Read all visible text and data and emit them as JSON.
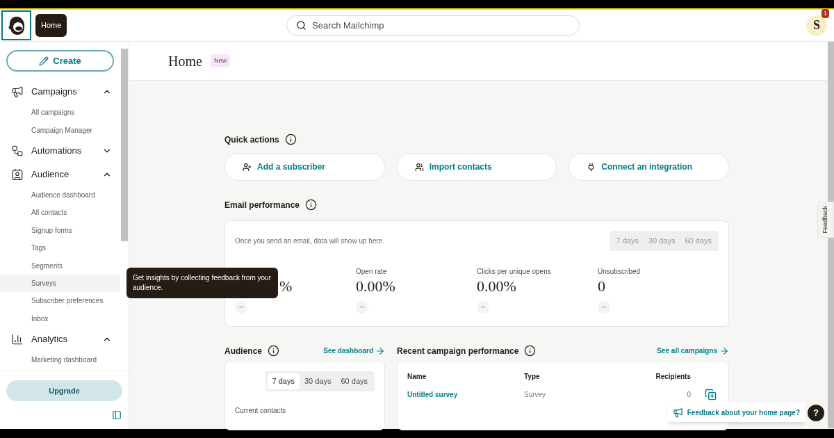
{
  "header": {
    "logo_tooltip": "Home",
    "search": {
      "placeholder": "Search Mailchimp"
    },
    "avatar": {
      "initial": "S",
      "badge": "1"
    }
  },
  "sidebar": {
    "create_button": "Create",
    "groups": [
      {
        "label": "Campaigns",
        "expanded": true,
        "items": [
          {
            "label": "All campaigns",
            "highlighted": false
          },
          {
            "label": "Campaign Manager",
            "highlighted": false
          }
        ]
      },
      {
        "label": "Automations",
        "expanded": false
      },
      {
        "label": "Audience",
        "expanded": true,
        "items": [
          {
            "label": "Audience dashboard",
            "highlighted": false
          },
          {
            "label": "All contacts",
            "highlighted": false
          },
          {
            "label": "Signup forms",
            "highlighted": false
          },
          {
            "label": "Tags",
            "highlighted": false
          },
          {
            "label": "Segments",
            "highlighted": false
          },
          {
            "label": "Surveys",
            "highlighted": true
          },
          {
            "label": "Subscriber preferences",
            "highlighted": false
          },
          {
            "label": "Inbox",
            "highlighted": false
          }
        ]
      },
      {
        "label": "Analytics",
        "expanded": true,
        "items": [
          {
            "label": "Marketing dashboard",
            "highlighted": false
          }
        ]
      }
    ],
    "tooltip": "Get insights by collecting feedback from your audience.",
    "upgrade_button": "Upgrade"
  },
  "page": {
    "title": "Home",
    "badge": "New"
  },
  "quick_actions": {
    "title": "Quick actions",
    "actions": [
      {
        "label": "Add a subscriber"
      },
      {
        "label": "Import contacts"
      },
      {
        "label": "Connect an integration"
      }
    ]
  },
  "email_performance": {
    "title": "Email performance",
    "note": "Once you send an email, data will show up here.",
    "ranges_disabled": true,
    "ranges": [
      {
        "label": "7 days",
        "selected": false
      },
      {
        "label": "30 days",
        "selected": false
      },
      {
        "label": "60 days",
        "selected": false
      }
    ],
    "metrics": [
      {
        "value": "%",
        "change": "--"
      },
      {
        "label": "Open rate",
        "value": "0.00%",
        "change": "--"
      },
      {
        "label": "Clicks per unique opens",
        "value": "0.00%",
        "change": "--"
      },
      {
        "label": "Unsubscribed",
        "value": "0",
        "change": "--"
      }
    ]
  },
  "audience": {
    "title": "Audience",
    "link": "See dashboard",
    "ranges": [
      {
        "label": "7 days",
        "selected": true
      },
      {
        "label": "30 days",
        "selected": false
      },
      {
        "label": "60 days",
        "selected": false
      }
    ],
    "current_contacts_label": "Current contacts"
  },
  "recent_campaigns": {
    "title": "Recent campaign performance",
    "link": "See all campaigns",
    "columns": [
      "Name",
      "Type",
      "Recipients"
    ],
    "rows": [
      {
        "name": "Untitled survey",
        "type": "Survey",
        "recipients": "0"
      }
    ]
  },
  "feedback_tab": "Feedback",
  "feedback_prompt": "Feedback about your home page?",
  "help_button": "?"
}
